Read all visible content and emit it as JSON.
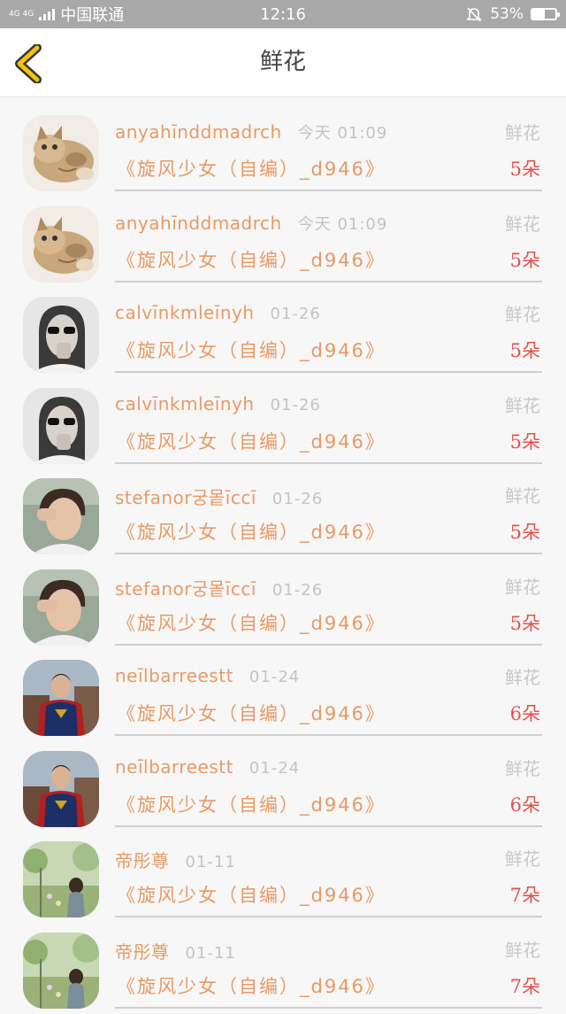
{
  "status_bar": {
    "network": "4G 4G",
    "carrier": "中国联通",
    "time": "12:16",
    "battery_text": "53%",
    "battery_level": 0.53
  },
  "header": {
    "title": "鲜花",
    "back_icon": "chevron-left-icon",
    "accent": "#f5c400"
  },
  "colors": {
    "name": "#e89a66",
    "count": "#e0534b",
    "muted": "#c4c4c4"
  },
  "records": [
    {
      "user": "anyahīnddmadrch",
      "time": "今天 01:09",
      "type": "鲜花",
      "book": "《旋风少女（自编）_d946》",
      "count": "5朵",
      "avatar": "cat"
    },
    {
      "user": "anyahīnddmadrch",
      "time": "今天 01:09",
      "type": "鲜花",
      "book": "《旋风少女（自编）_d946》",
      "count": "5朵",
      "avatar": "cat"
    },
    {
      "user": "calvīnkmleīnyh",
      "time": "01-26",
      "type": "鲜花",
      "book": "《旋风少女（自编）_d946》",
      "count": "5朵",
      "avatar": "woman-sunglasses"
    },
    {
      "user": "calvīnkmleīnyh",
      "time": "01-26",
      "type": "鲜花",
      "book": "《旋风少女（自编）_d946》",
      "count": "5朵",
      "avatar": "woman-sunglasses"
    },
    {
      "user": "stefanor궁뫁īccī",
      "time": "01-26",
      "type": "鲜花",
      "book": "《旋风少女（自编）_d946》",
      "count": "5朵",
      "avatar": "young-man"
    },
    {
      "user": "stefanor궁뫁īccī",
      "time": "01-26",
      "type": "鲜花",
      "book": "《旋风少女（自编）_d946》",
      "count": "5朵",
      "avatar": "young-man"
    },
    {
      "user": "neīlbarreestt",
      "time": "01-24",
      "type": "鲜花",
      "book": "《旋风少女（自编）_d946》",
      "count": "6朵",
      "avatar": "superhero"
    },
    {
      "user": "neīlbarreestt",
      "time": "01-24",
      "type": "鲜花",
      "book": "《旋风少女（自编）_d946》",
      "count": "6朵",
      "avatar": "superhero"
    },
    {
      "user": "帝彤尊",
      "time": "01-11",
      "type": "鲜花",
      "book": "《旋风少女（自编）_d946》",
      "count": "7朵",
      "avatar": "garden"
    },
    {
      "user": "帝彤尊",
      "time": "01-11",
      "type": "鲜花",
      "book": "《旋风少女（自编）_d946》",
      "count": "7朵",
      "avatar": "garden"
    }
  ]
}
